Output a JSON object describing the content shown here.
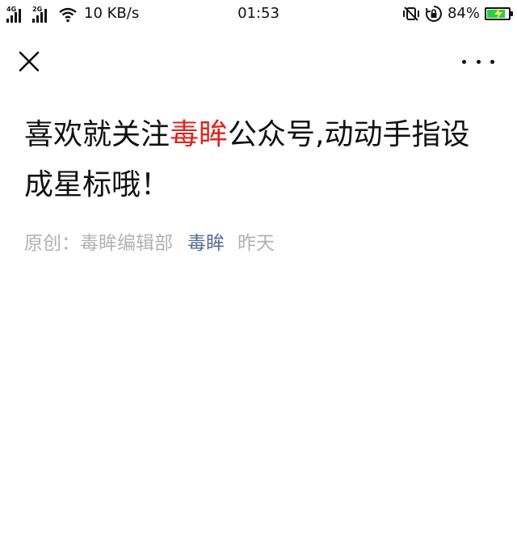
{
  "status_bar": {
    "signal_1_label": "4G",
    "signal_2_label": "2G",
    "network_speed": "10 KB/s",
    "time": "01:53",
    "battery_percent": "84%",
    "battery_level": 0.84,
    "battery_color": "#2ecc40",
    "icons": [
      "signal-icon",
      "wifi-icon",
      "vibrate-off-icon",
      "rotation-lock-icon",
      "battery-icon",
      "charging-icon"
    ]
  },
  "nav": {
    "close_icon": "close-icon",
    "more_icon": "more-icon"
  },
  "article": {
    "title_before": "喜欢就关注",
    "title_highlight": "毒眸",
    "title_after": "公众号,动动手指设成星标哦！",
    "highlight_color": "#e0241f",
    "original_label": "原创：毒眸编辑部",
    "account_name": "毒眸",
    "account_color": "#576b95",
    "date": "昨天"
  }
}
